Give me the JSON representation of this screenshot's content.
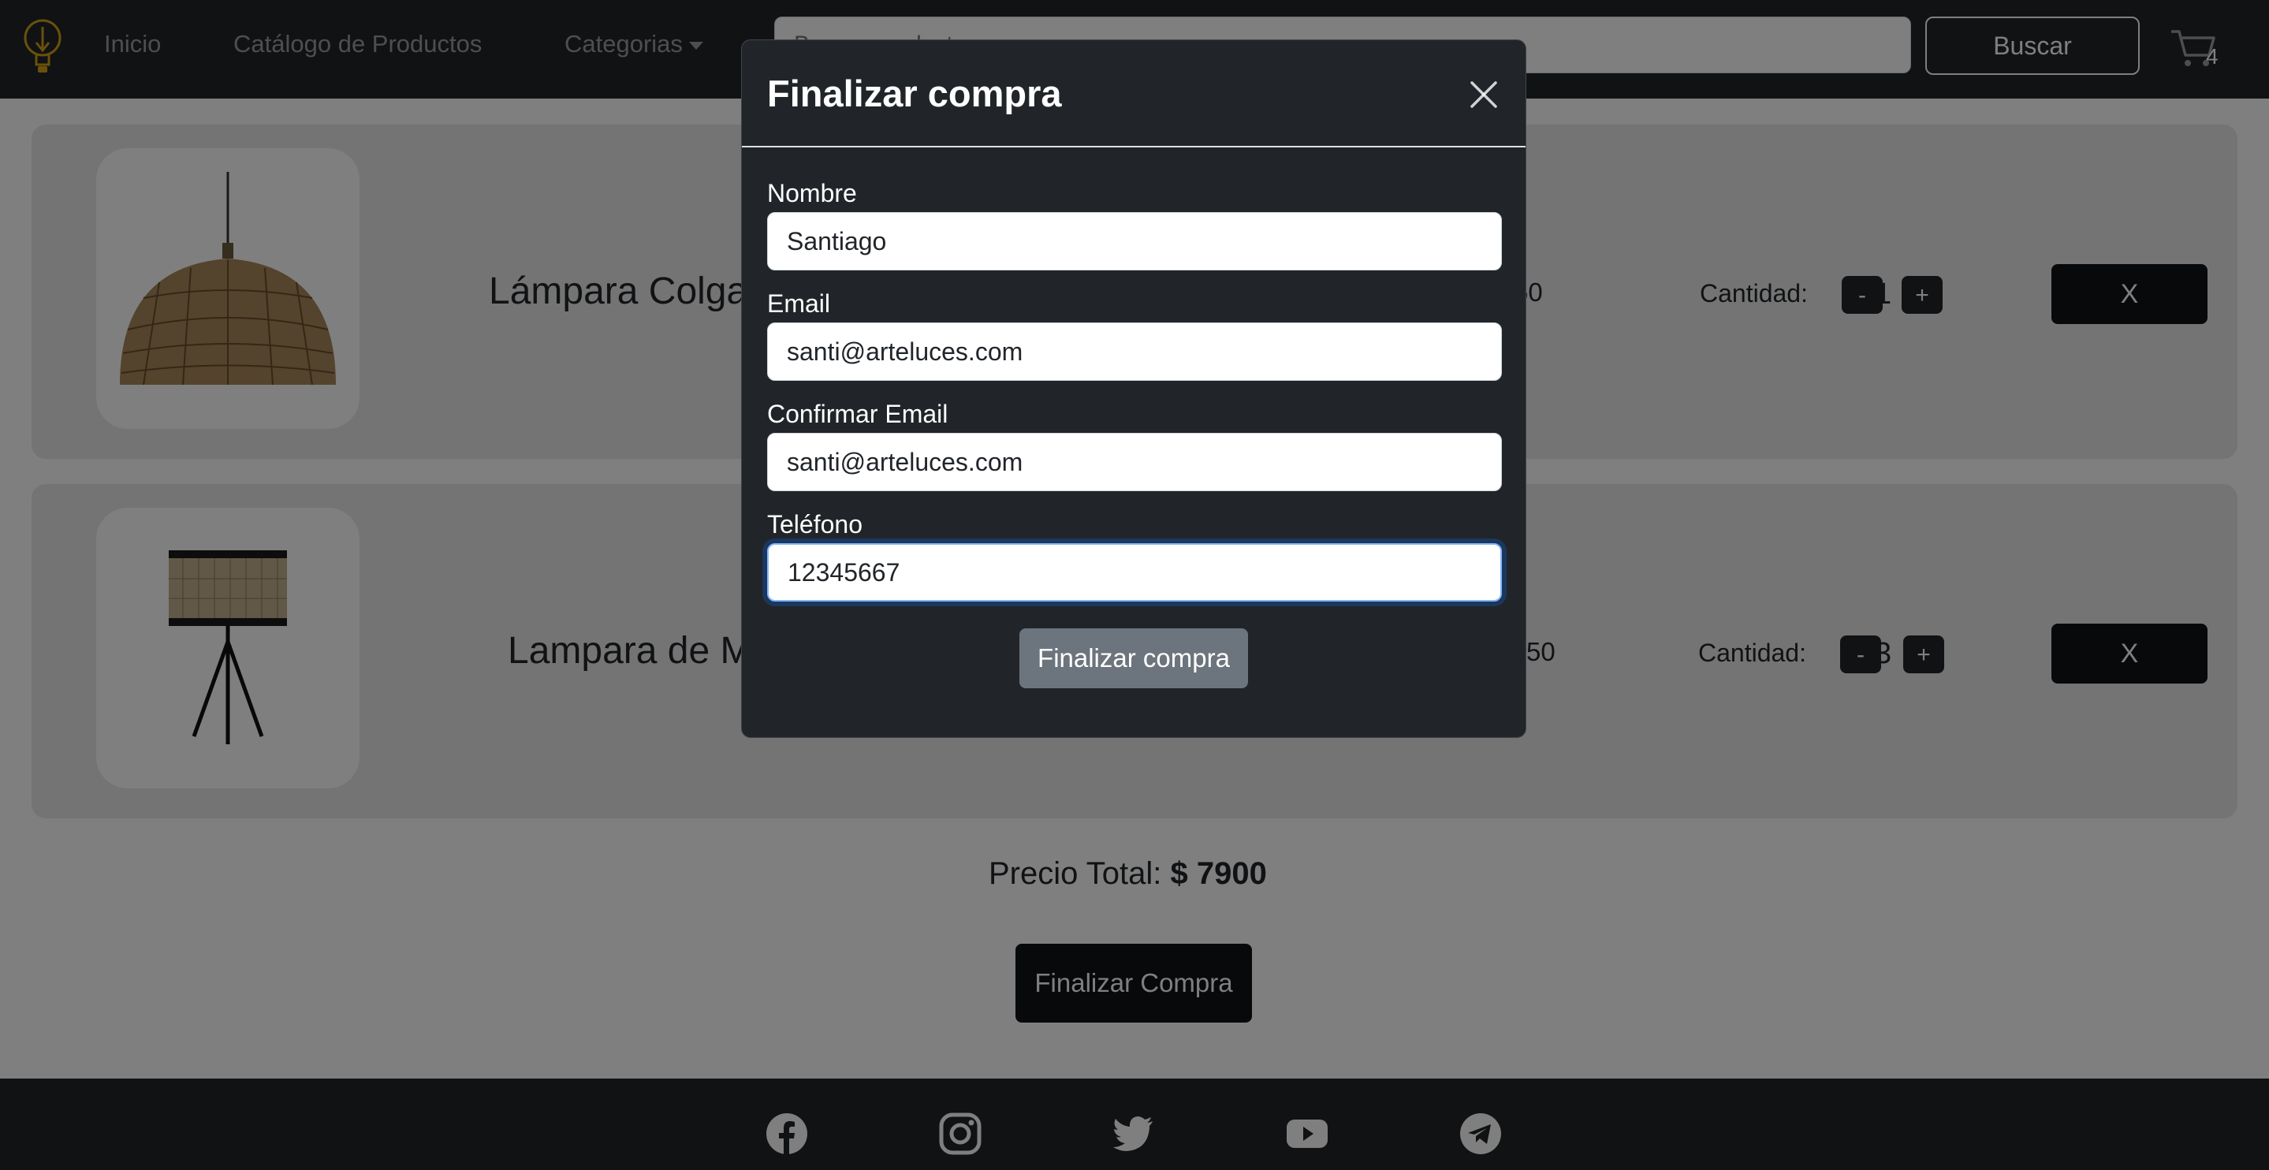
{
  "navbar": {
    "links": [
      "Inicio",
      "Catálogo de Productos",
      "Categorias"
    ],
    "search_placeholder": "Buscar producto",
    "search_button": "Buscar",
    "cart_count": "4"
  },
  "cart": {
    "items": [
      {
        "name": "Lámpara Colga",
        "price_fragment": "50",
        "qty_label": "Cantidad:",
        "quantity": "1",
        "minus": "-",
        "plus": "+",
        "remove": "X"
      },
      {
        "name": "Lampara de M",
        "price_fragment": "50",
        "qty_label": "Cantidad:",
        "quantity": "3",
        "minus": "-",
        "plus": "+",
        "remove": "X"
      }
    ],
    "total_label": "Precio Total:",
    "total_value": "$ 7900",
    "checkout_button": "Finalizar Compra"
  },
  "modal": {
    "title": "Finalizar compra",
    "fields": [
      {
        "label": "Nombre",
        "value": "Santiago"
      },
      {
        "label": "Email",
        "value": "santi@arteluces.com"
      },
      {
        "label": "Confirmar Email",
        "value": "santi@arteluces.com"
      },
      {
        "label": "Teléfono",
        "value": "12345667"
      }
    ],
    "submit_button": "Finalizar compra"
  },
  "footer": {
    "social_icons": [
      "facebook-icon",
      "instagram-icon",
      "twitter-icon",
      "youtube-icon",
      "telegram-icon"
    ]
  },
  "colors": {
    "navbar_bg": "#212529",
    "modal_bg": "#212529",
    "dark_button": "#111316",
    "secondary_button": "#6c757d",
    "focus_ring": "#86b7fe"
  }
}
